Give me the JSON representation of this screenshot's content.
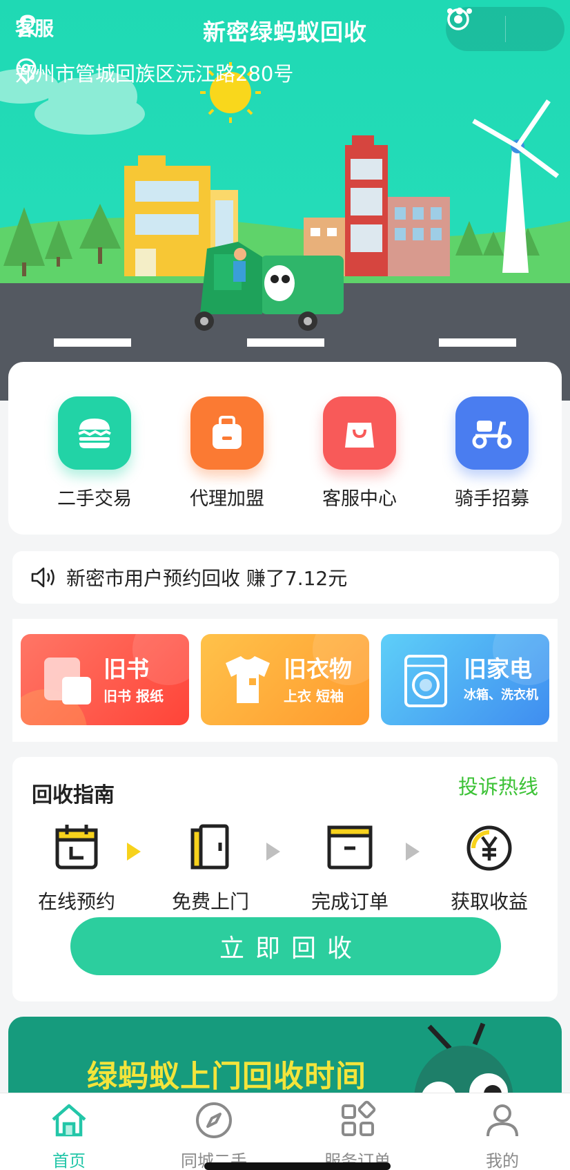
{
  "header": {
    "service_label": "客服",
    "title": "新密绿蚂蚁回收",
    "address": "郑州市管城回族区沅江路280号"
  },
  "categories": [
    {
      "label": "二手交易",
      "icon": "burger-icon",
      "color": "#22d3a6"
    },
    {
      "label": "代理加盟",
      "icon": "bag-icon",
      "color": "#fb7a33"
    },
    {
      "label": "客服中心",
      "icon": "shopping-bag-icon",
      "color": "#f85a59"
    },
    {
      "label": "骑手招募",
      "icon": "scooter-icon",
      "color": "#4a7df0"
    }
  ],
  "notice": {
    "text": "新密市用户预约回收 赚了7.12元"
  },
  "recycle_types": [
    {
      "title": "旧书",
      "subtitle": "旧书 报纸",
      "colors": [
        "#ff6e61",
        "#ff4438"
      ]
    },
    {
      "title": "旧衣物",
      "subtitle": "上衣 短袖",
      "colors": [
        "#ffc24a",
        "#ff9a2e"
      ]
    },
    {
      "title": "旧家电",
      "subtitle": "冰箱、洗衣机",
      "colors": [
        "#5ecff8",
        "#3f8df0"
      ]
    }
  ],
  "guide": {
    "title": "回收指南",
    "hotline_label": "投诉热线",
    "steps": [
      {
        "label": "在线预约",
        "icon": "calendar-icon"
      },
      {
        "label": "免费上门",
        "icon": "door-icon"
      },
      {
        "label": "完成订单",
        "icon": "box-icon"
      },
      {
        "label": "获取收益",
        "icon": "yen-coin-icon"
      }
    ],
    "button_label": "立即回收"
  },
  "banner": {
    "text": "绿蚂蚁上门回收时间"
  },
  "tabbar": {
    "items": [
      {
        "label": "首页",
        "icon": "home-icon",
        "active": true
      },
      {
        "label": "同城二手",
        "icon": "compass-icon",
        "active": false
      },
      {
        "label": "服务订单",
        "icon": "grid-icon",
        "active": false
      },
      {
        "label": "我的",
        "icon": "person-icon",
        "active": false
      }
    ]
  },
  "colors": {
    "brand": "#23c6a8",
    "button": "#2cce9e",
    "hotline": "#3cc236"
  }
}
